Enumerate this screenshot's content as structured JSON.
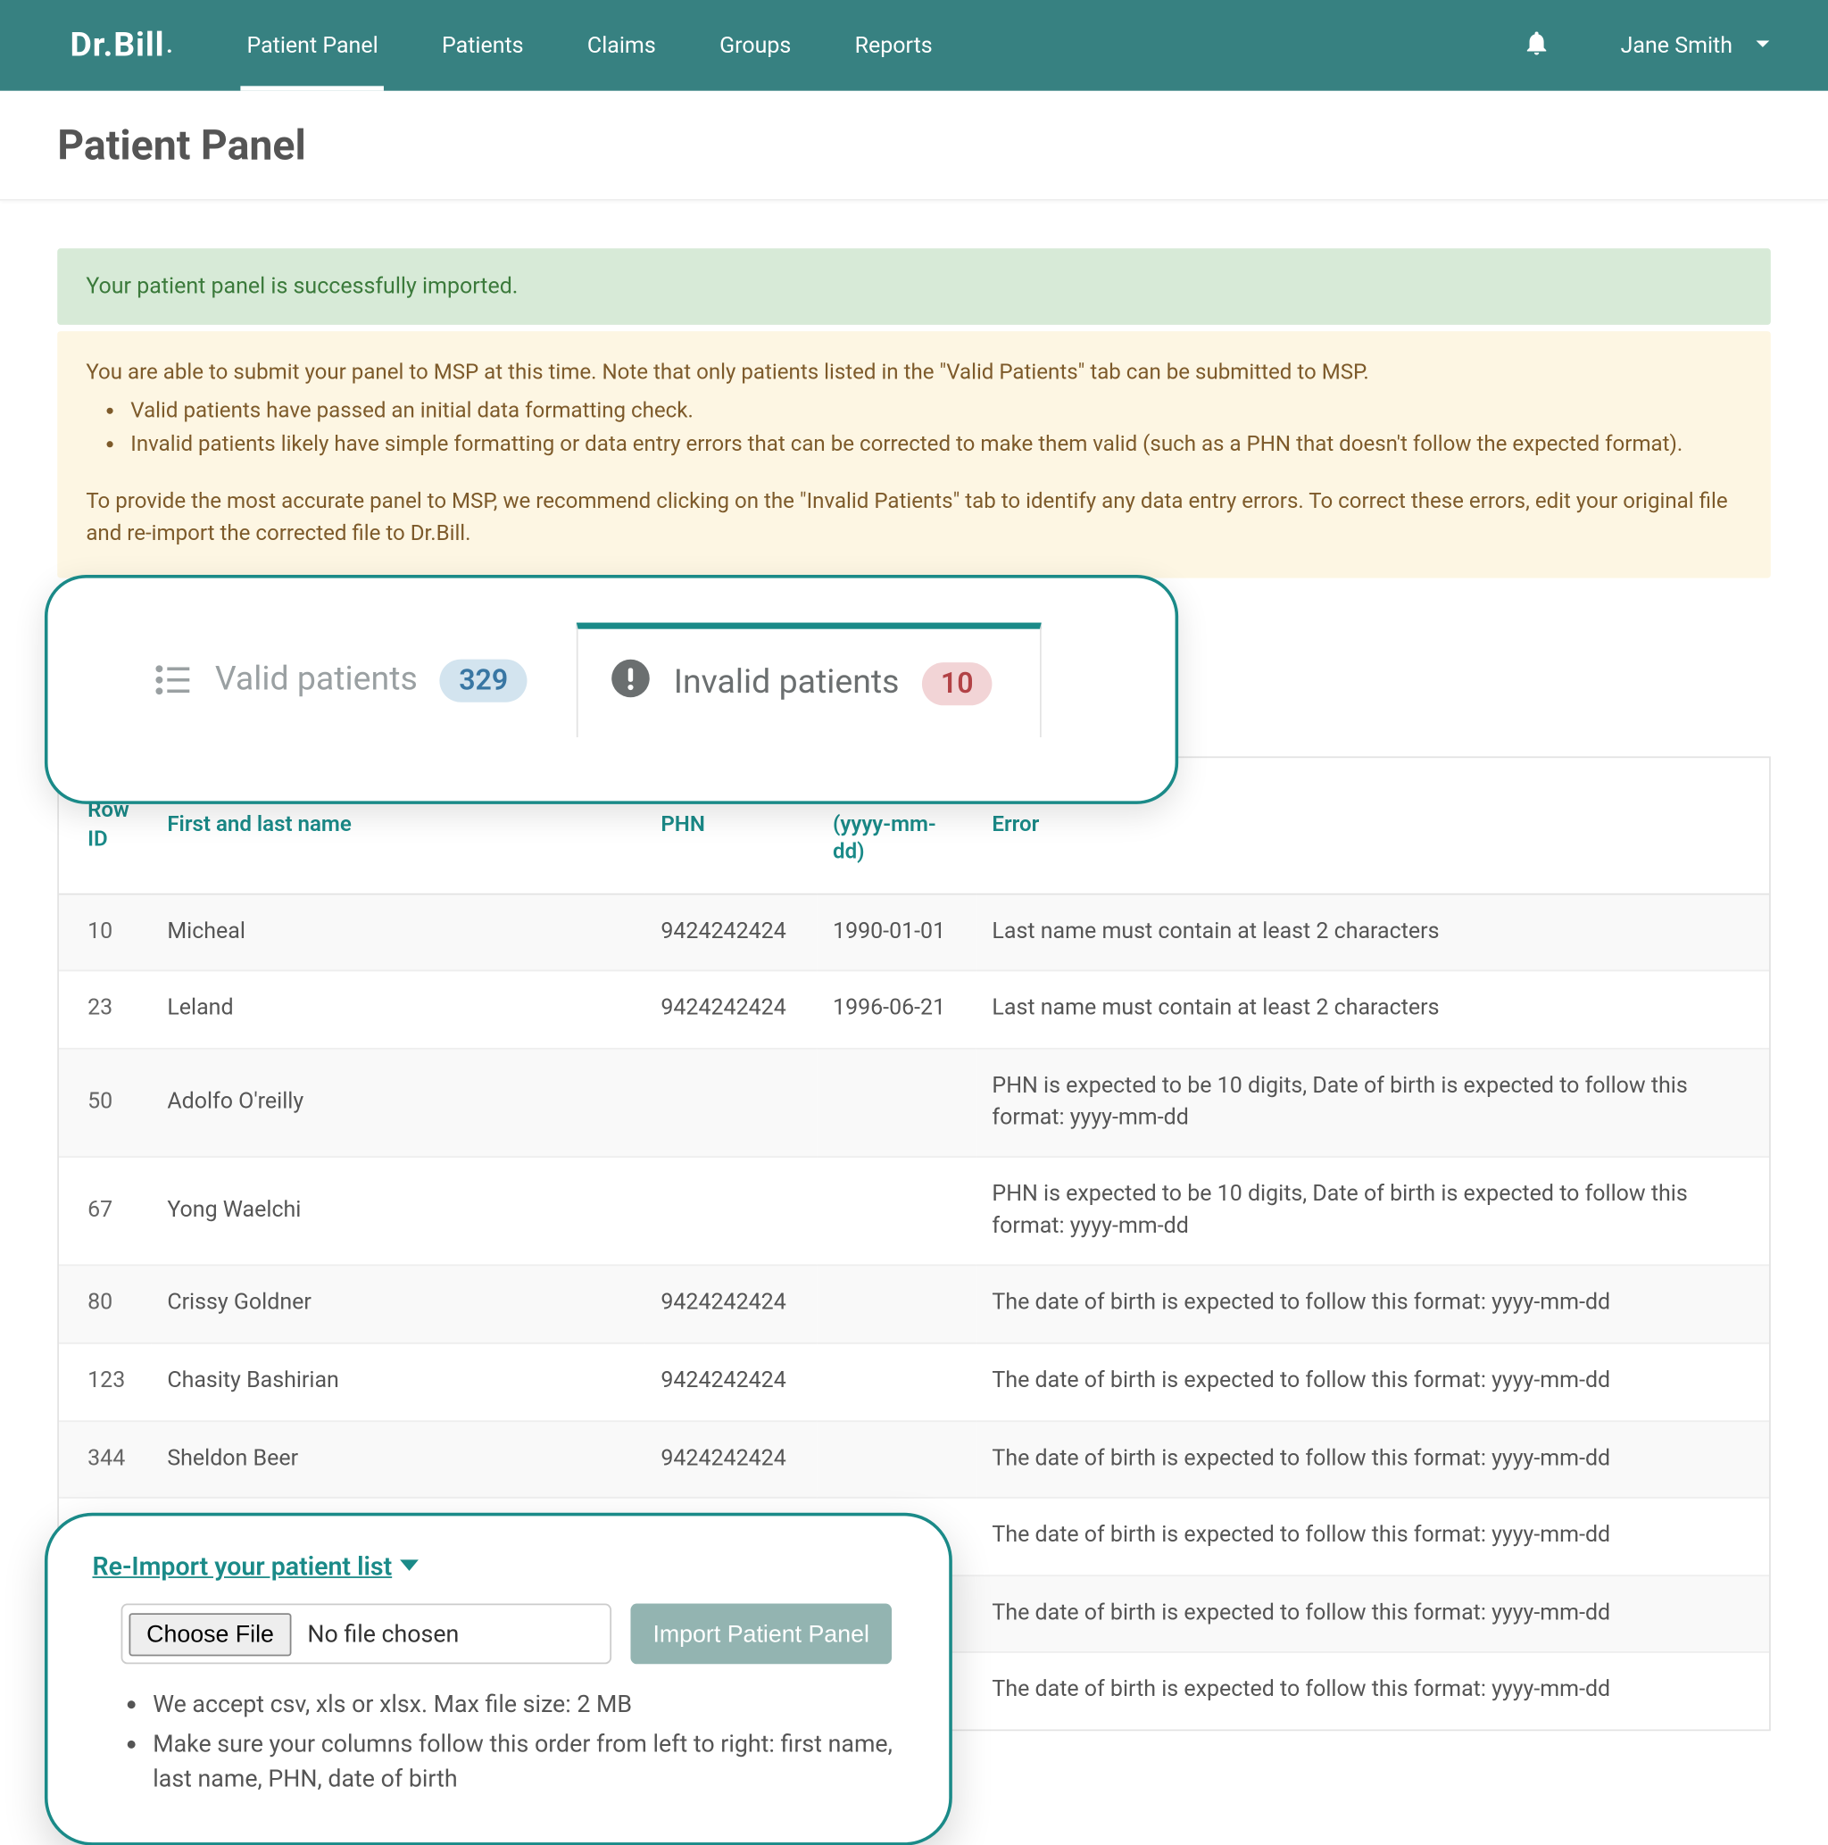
{
  "brand": "Dr.Bill",
  "nav": {
    "items": [
      {
        "label": "Patient Panel"
      },
      {
        "label": "Patients"
      },
      {
        "label": "Claims"
      },
      {
        "label": "Groups"
      },
      {
        "label": "Reports"
      }
    ],
    "user": "Jane Smith"
  },
  "page": {
    "title": "Patient Panel"
  },
  "alerts": {
    "success": "Your patient panel is successfully imported.",
    "warning": {
      "line1": "You are able to submit your panel to MSP at this time. Note that only patients listed in the \"Valid Patients\" tab can be submitted to MSP.",
      "bullet1": "Valid patients have passed an initial data formatting check.",
      "bullet2": "Invalid patients likely have simple formatting or data entry errors that can be corrected to make them valid (such as a PHN that doesn't follow the expected format).",
      "line2": "To provide the most accurate panel to MSP, we recommend clicking on the \"Invalid Patients\" tab to identify any data entry errors. To correct these errors, edit your original file and re-import the corrected file to Dr.Bill."
    }
  },
  "tabs": {
    "valid": {
      "label": "Valid patients",
      "count": "329"
    },
    "invalid": {
      "label": "Invalid patients",
      "count": "10"
    }
  },
  "table": {
    "headers": {
      "rowid": "Row ID",
      "name": "First and last name",
      "phn": "PHN",
      "dob": "Date of birth\n(yyyy-mm-dd)",
      "error": "Error"
    },
    "rows": [
      {
        "rowid": "10",
        "name": "Micheal",
        "phn": "9424242424",
        "dob": "1990-01-01",
        "error": "Last name must contain at least 2 characters"
      },
      {
        "rowid": "23",
        "name": "Leland",
        "phn": "9424242424",
        "dob": "1996-06-21",
        "error": "Last name must contain at least 2 characters"
      },
      {
        "rowid": "50",
        "name": "Adolfo O'reilly",
        "phn": "",
        "dob": "",
        "error": "PHN is expected to be 10 digits, Date of birth is expected to follow this format: yyyy-mm-dd"
      },
      {
        "rowid": "67",
        "name": "Yong Waelchi",
        "phn": "",
        "dob": "",
        "error": "PHN is expected to be 10 digits, Date of birth is expected to follow this format: yyyy-mm-dd"
      },
      {
        "rowid": "80",
        "name": "Crissy Goldner",
        "phn": "9424242424",
        "dob": "",
        "error": "The date of birth is expected to follow this format: yyyy-mm-dd"
      },
      {
        "rowid": "123",
        "name": "Chasity Bashirian",
        "phn": "9424242424",
        "dob": "",
        "error": "The date of birth is expected to follow this format: yyyy-mm-dd"
      },
      {
        "rowid": "344",
        "name": "Sheldon Beer",
        "phn": "9424242424",
        "dob": "",
        "error": "The date of birth is expected to follow this format: yyyy-mm-dd"
      },
      {
        "rowid": "",
        "name": "",
        "phn": "",
        "dob": "",
        "error": "The date of birth is expected to follow this format: yyyy-mm-dd"
      },
      {
        "rowid": "",
        "name": "",
        "phn": "",
        "dob": "",
        "error": "The date of birth is expected to follow this format: yyyy-mm-dd"
      },
      {
        "rowid": "",
        "name": "",
        "phn": "",
        "dob": "",
        "error": "The date of birth is expected to follow this format: yyyy-mm-dd"
      }
    ]
  },
  "reimport": {
    "title": "Re-Import your patient list",
    "choose_file": "Choose File",
    "no_file": "No file chosen",
    "button": "Import Patient Panel",
    "note1": "We accept csv, xls or xlsx. Max file size: 2 MB",
    "note2": "Make sure your columns follow this order from left to right: first name, last name, PHN, date of birth"
  }
}
